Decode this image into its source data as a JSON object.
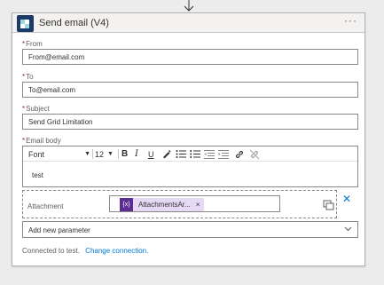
{
  "header": {
    "title": "Send email (V4)",
    "more_label": "···"
  },
  "fields": {
    "from": {
      "label": "From",
      "value": "From@email.com"
    },
    "to": {
      "label": "To",
      "value": "To@email.com"
    },
    "subject": {
      "label": "Subject",
      "value": "Send Grid Limitation"
    },
    "body": {
      "label": "Email body",
      "font": "Font",
      "font_size": "12",
      "content": "test"
    }
  },
  "attachment": {
    "label": "Attachment",
    "token_icon": "{x}",
    "token_text": "AttachmentsAr...",
    "token_close": "×"
  },
  "add_parameter": {
    "placeholder": "Add new parameter"
  },
  "footer": {
    "status": "Connected to test.",
    "link": "Change connection."
  },
  "icons": {
    "logo": "sendgrid-logo-icon",
    "bold": "B",
    "italic": "I",
    "underline": "U"
  },
  "colors": {
    "accent": "#0078d4",
    "token_bg": "#e5d9f5",
    "token_icon_bg": "#5c2d91",
    "required": "#a4262c"
  }
}
